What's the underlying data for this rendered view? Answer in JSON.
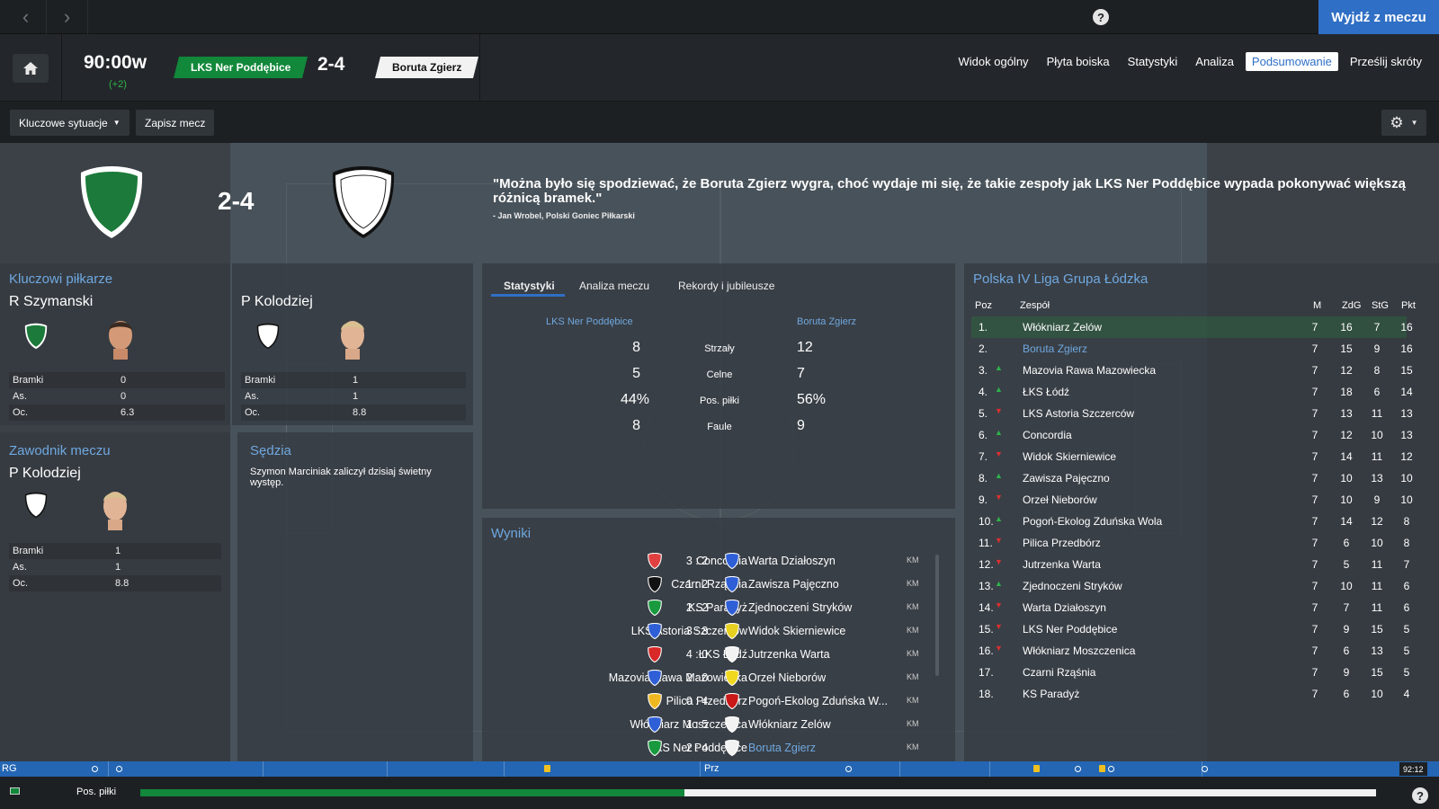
{
  "nav": {
    "back_icon": "‹",
    "forward_icon": "›",
    "help_glyph": "?",
    "exit_label": "Wyjdź z meczu"
  },
  "match": {
    "clock": "90:00w",
    "added_time": "(+2)",
    "home_team": "LKS Ner Poddębice",
    "away_team": "Boruta Zgierz",
    "score": "2-4",
    "tabs": [
      "Widok ogólny",
      "Płyta boiska",
      "Statystyki",
      "Analiza",
      "Podsumowanie",
      "Prześlij skróty"
    ],
    "active_tab": "Podsumowanie"
  },
  "toolbar": {
    "key_moments": "Kluczowe sytuacje",
    "save_match": "Zapisz mecz"
  },
  "colors": {
    "home": "#11883a",
    "away": "#f2f2f2",
    "accent": "#2f6fc5",
    "link": "#6fa8e0"
  },
  "summary": {
    "score": "2-4",
    "quote": "\"Można było się spodziewać, że Boruta Zgierz wygra, choć wydaje mi się, że takie zespoły jak LKS Ner Poddębice wypada pokonywać większą różnicą bramek.\"",
    "quote_author": "- Jan Wrobel, Polski Goniec Piłkarski"
  },
  "key_players": {
    "title": "Kluczowi piłkarze",
    "home": {
      "name": "R Szymanski",
      "goals_label": "Bramki",
      "goals": "0",
      "assists_label": "As.",
      "assists": "0",
      "rating_label": "Oc.",
      "rating": "6.3"
    },
    "away": {
      "name": "P Kolodziej",
      "goals_label": "Bramki",
      "goals": "1",
      "assists_label": "As.",
      "assists": "1",
      "rating_label": "Oc.",
      "rating": "8.8"
    }
  },
  "motm": {
    "title": "Zawodnik meczu",
    "name": "P Kolodziej",
    "goals_label": "Bramki",
    "goals": "1",
    "assists_label": "As.",
    "assists": "1",
    "rating_label": "Oc.",
    "rating": "8.8"
  },
  "referee": {
    "title": "Sędzia",
    "text": "Szymon Marciniak zaliczył dzisiaj świetny występ."
  },
  "center": {
    "tabs": [
      "Statystyki",
      "Analiza meczu",
      "Rekordy i jubileusze"
    ],
    "home_team": "LKS Ner Poddębice",
    "away_team": "Boruta Zgierz",
    "stats": [
      {
        "label": "Strzały",
        "home": "8",
        "away": "12"
      },
      {
        "label": "Celne",
        "home": "5",
        "away": "7"
      },
      {
        "label": "Pos. piłki",
        "home": "44%",
        "away": "56%"
      },
      {
        "label": "Faule",
        "home": "8",
        "away": "9"
      }
    ]
  },
  "results": {
    "title": "Wyniki",
    "rows": [
      {
        "home": "Concordia",
        "score": "3 : 2",
        "away": "Warta Działoszyn",
        "km": "KM",
        "hc": "#e14040",
        "ac": "#2f5fd6",
        "away_link": false
      },
      {
        "home": "Czarni Rząśnia",
        "score": "1 : 2",
        "away": "Zawisza Pajęczno",
        "km": "KM",
        "hc": "#111111",
        "ac": "#2f5fd6",
        "away_link": false
      },
      {
        "home": "KS Paradyż",
        "score": "2 : 2",
        "away": "Zjednoczeni Stryków",
        "km": "KM",
        "hc": "#1a9a3e",
        "ac": "#2f5fd6",
        "away_link": false
      },
      {
        "home": "LKS Astoria Szczerców",
        "score": "3 : 3",
        "away": "Widok Skierniewice",
        "km": "KM",
        "hc": "#2f5fd6",
        "ac": "#e8d020",
        "away_link": false
      },
      {
        "home": "ŁKS Łódź",
        "score": "4 : 0",
        "away": "Jutrzenka Warta",
        "km": "KM",
        "hc": "#d82828",
        "ac": "#f2f2f2",
        "away_link": false
      },
      {
        "home": "Mazovia Rawa Mazowiecka",
        "score": "2 : 0",
        "away": "Orzeł Nieborów",
        "km": "KM",
        "hc": "#2f5fd6",
        "ac": "#f0d820",
        "away_link": false
      },
      {
        "home": "Pilica Przedbórz",
        "score": "0 : 4",
        "away": "Pogoń-Ekolog Zduńska W...",
        "km": "KM",
        "hc": "#f0b820",
        "ac": "#c81818",
        "away_link": false
      },
      {
        "home": "Włókniarz Moszczenica",
        "score": "1 : 5",
        "away": "Włókniarz Zelów",
        "km": "KM",
        "hc": "#2f5fd6",
        "ac": "#f2f2f2",
        "away_link": false
      },
      {
        "home": "LKS Ner Poddębice",
        "score": "2 : 4",
        "away": "Boruta Zgierz",
        "km": "KM",
        "hc": "#1a9a3e",
        "ac": "#f2f2f2",
        "away_link": true
      }
    ]
  },
  "league": {
    "title": "Polska IV Liga Grupa Łódzka",
    "headers": {
      "pos": "Poz",
      "team": "Zespół",
      "m": "M",
      "zdg": "ZdG",
      "stg": "StG",
      "pkt": "Pkt"
    },
    "rows": [
      {
        "pos": "1.",
        "trend": "",
        "team": "Włókniarz Zelów",
        "m": "7",
        "zdg": "16",
        "stg": "7",
        "pkt": "16"
      },
      {
        "pos": "2.",
        "trend": "",
        "team": "Boruta Zgierz",
        "m": "7",
        "zdg": "15",
        "stg": "9",
        "pkt": "16"
      },
      {
        "pos": "3.",
        "trend": "up",
        "team": "Mazovia Rawa Mazowiecka",
        "m": "7",
        "zdg": "12",
        "stg": "8",
        "pkt": "15"
      },
      {
        "pos": "4.",
        "trend": "up",
        "team": "ŁKS Łódź",
        "m": "7",
        "zdg": "18",
        "stg": "6",
        "pkt": "14"
      },
      {
        "pos": "5.",
        "trend": "down",
        "team": "LKS Astoria Szczerców",
        "m": "7",
        "zdg": "13",
        "stg": "11",
        "pkt": "13"
      },
      {
        "pos": "6.",
        "trend": "up",
        "team": "Concordia",
        "m": "7",
        "zdg": "12",
        "stg": "10",
        "pkt": "13"
      },
      {
        "pos": "7.",
        "trend": "down",
        "team": "Widok Skierniewice",
        "m": "7",
        "zdg": "14",
        "stg": "11",
        "pkt": "12"
      },
      {
        "pos": "8.",
        "trend": "up",
        "team": "Zawisza Pajęczno",
        "m": "7",
        "zdg": "10",
        "stg": "13",
        "pkt": "10"
      },
      {
        "pos": "9.",
        "trend": "down",
        "team": "Orzeł Nieborów",
        "m": "7",
        "zdg": "10",
        "stg": "9",
        "pkt": "10"
      },
      {
        "pos": "10.",
        "trend": "up",
        "team": "Pogoń-Ekolog Zduńska Wola",
        "m": "7",
        "zdg": "14",
        "stg": "12",
        "pkt": "8"
      },
      {
        "pos": "11.",
        "trend": "down",
        "team": "Pilica Przedbórz",
        "m": "7",
        "zdg": "6",
        "stg": "10",
        "pkt": "8"
      },
      {
        "pos": "12.",
        "trend": "down",
        "team": "Jutrzenka Warta",
        "m": "7",
        "zdg": "5",
        "stg": "11",
        "pkt": "7"
      },
      {
        "pos": "13.",
        "trend": "up",
        "team": "Zjednoczeni Stryków",
        "m": "7",
        "zdg": "10",
        "stg": "11",
        "pkt": "6"
      },
      {
        "pos": "14.",
        "trend": "down",
        "team": "Warta Działoszyn",
        "m": "7",
        "zdg": "7",
        "stg": "11",
        "pkt": "6"
      },
      {
        "pos": "15.",
        "trend": "down",
        "team": "LKS Ner Poddębice",
        "m": "7",
        "zdg": "9",
        "stg": "15",
        "pkt": "5"
      },
      {
        "pos": "16.",
        "trend": "down",
        "team": "Włókniarz Moszczenica",
        "m": "7",
        "zdg": "6",
        "stg": "13",
        "pkt": "5"
      },
      {
        "pos": "17.",
        "trend": "",
        "team": "Czarni Rząśnia",
        "m": "7",
        "zdg": "9",
        "stg": "15",
        "pkt": "5"
      },
      {
        "pos": "18.",
        "trend": "",
        "team": "KS Paradyż",
        "m": "7",
        "zdg": "6",
        "stg": "10",
        "pkt": "4"
      }
    ]
  },
  "timeline": {
    "start_label": "RG",
    "mid_label": "Prz",
    "end_time": "92:12"
  },
  "possession": {
    "label": "Pos. piłki",
    "home_share": 0.44
  }
}
